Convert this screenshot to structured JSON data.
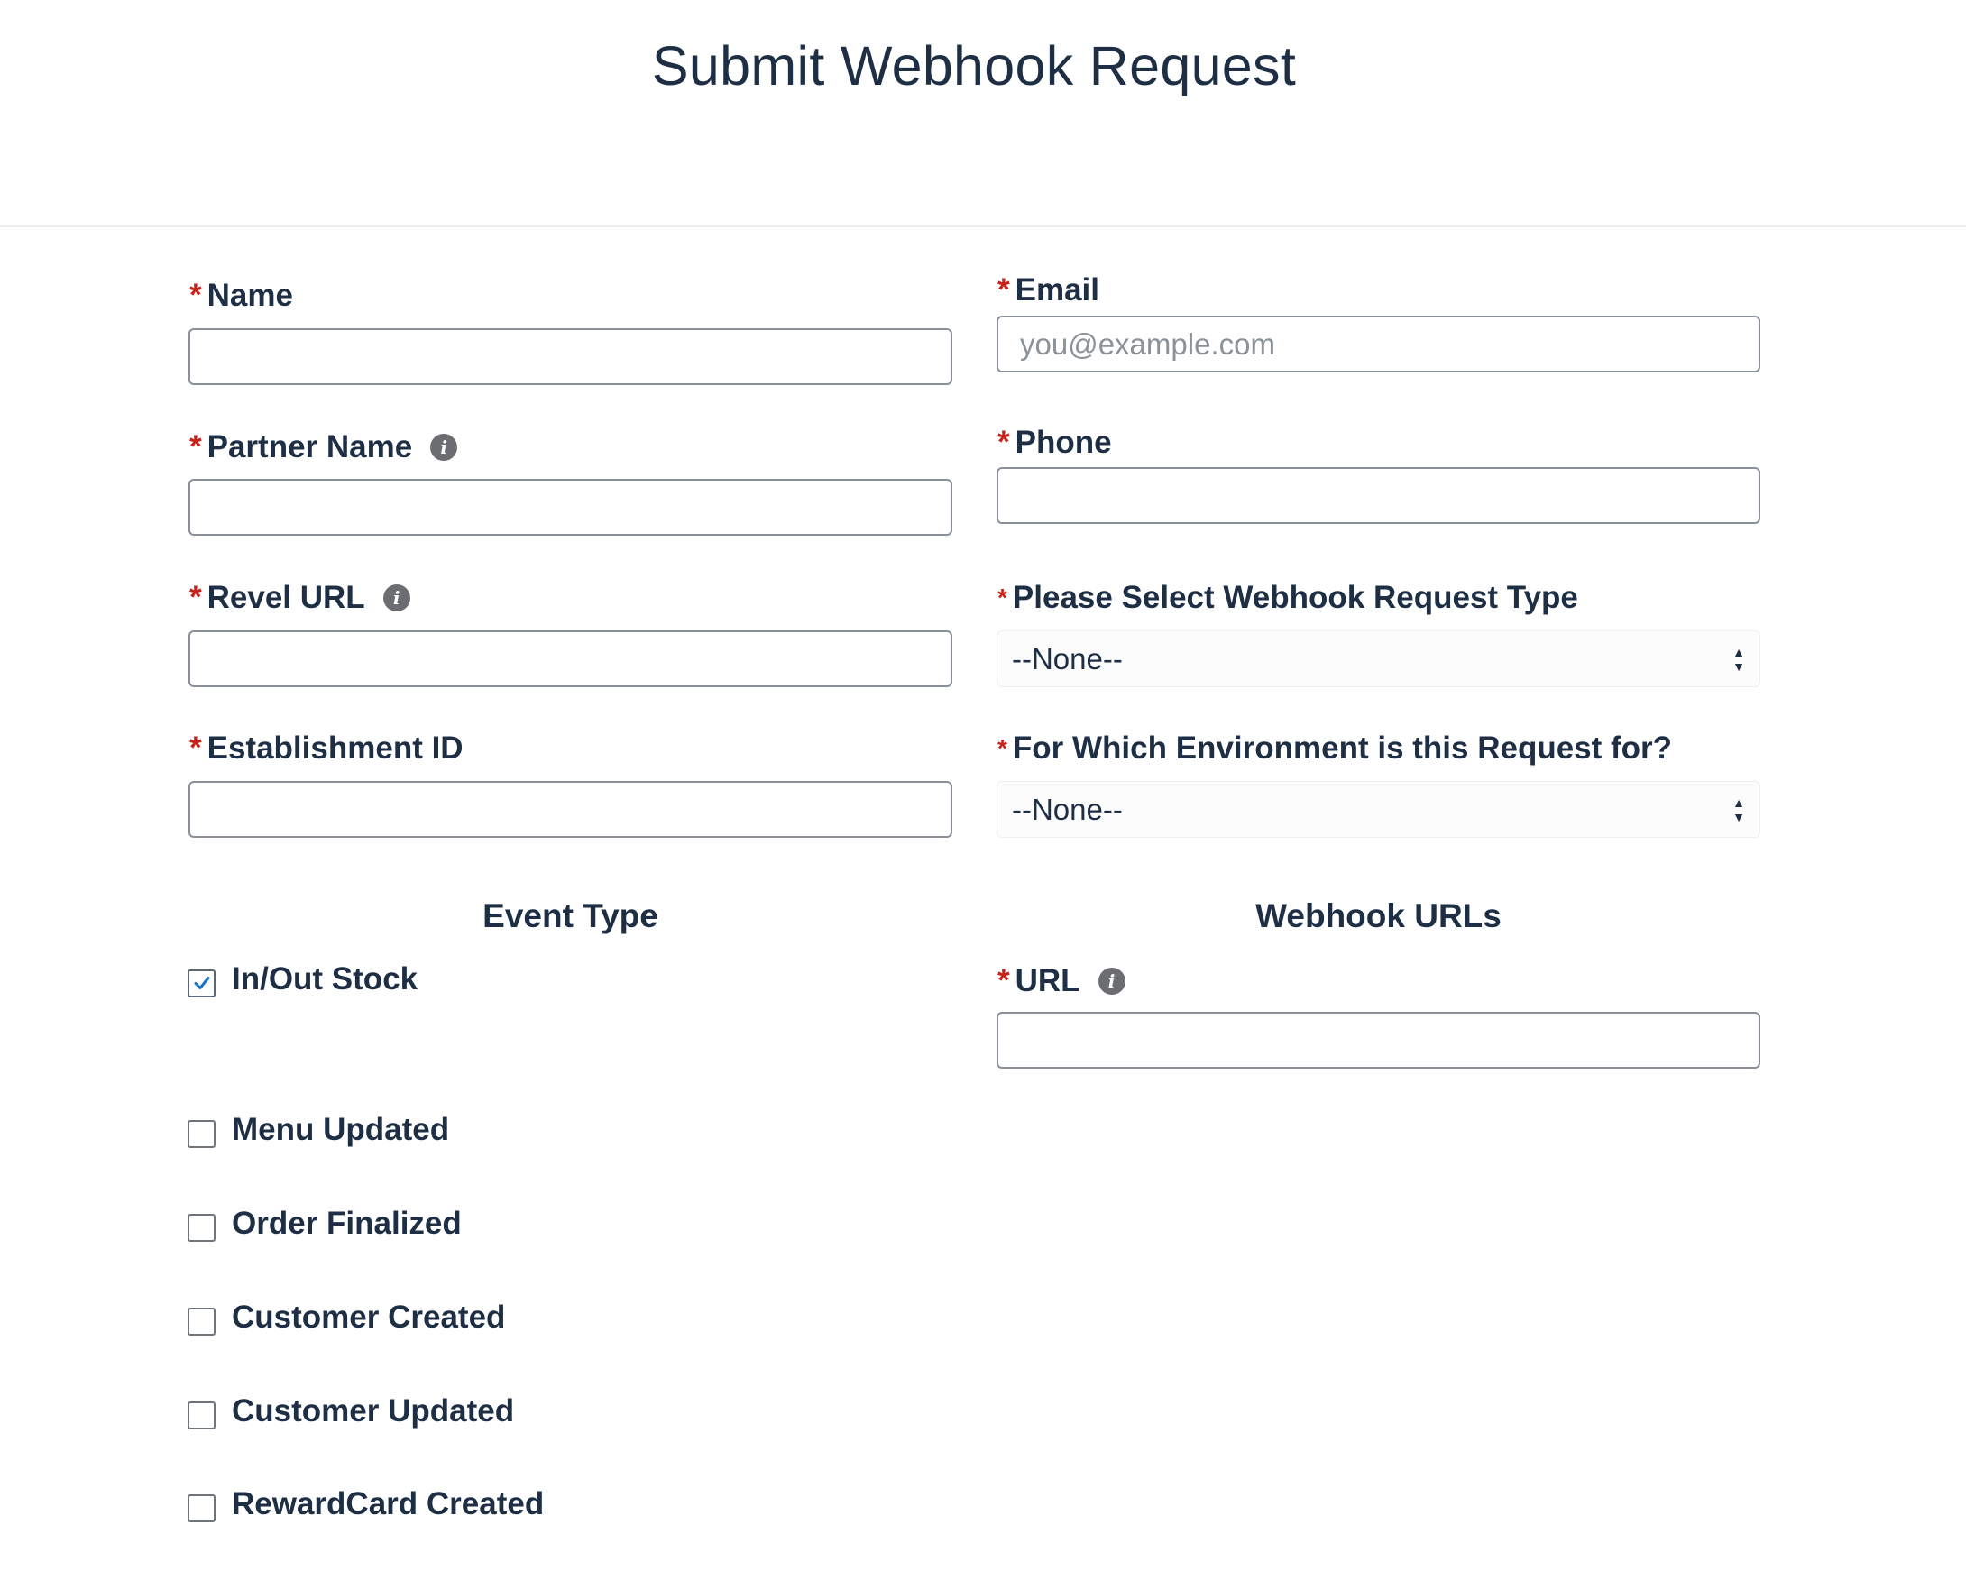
{
  "page": {
    "title": "Submit Webhook Request"
  },
  "form": {
    "required_marker": "*",
    "name": {
      "label": "Name",
      "value": "",
      "placeholder": ""
    },
    "email": {
      "label": "Email",
      "value": "",
      "placeholder": "you@example.com"
    },
    "partner_name": {
      "label": "Partner Name",
      "value": "",
      "placeholder": "",
      "info_icon": "info-icon"
    },
    "phone": {
      "label": "Phone",
      "value": "",
      "placeholder": ""
    },
    "revel_url": {
      "label": "Revel URL",
      "value": "",
      "placeholder": "",
      "info_icon": "info-icon"
    },
    "webhook_request_type": {
      "label": "Please Select Webhook Request Type",
      "selected": "--None--"
    },
    "establishment_id": {
      "label": "Establishment ID",
      "value": "",
      "placeholder": ""
    },
    "environment": {
      "label": "For Which Environment is this Request for?",
      "selected": "--None--"
    }
  },
  "event_type": {
    "heading": "Event Type",
    "items": [
      {
        "label": "In/Out Stock",
        "checked": true
      },
      {
        "label": "Menu Updated",
        "checked": false
      },
      {
        "label": "Order Finalized",
        "checked": false
      },
      {
        "label": "Customer Created",
        "checked": false
      },
      {
        "label": "Customer Updated",
        "checked": false
      },
      {
        "label": "RewardCard Created",
        "checked": false
      }
    ]
  },
  "webhook_urls": {
    "heading": "Webhook URLs",
    "url": {
      "label": "URL",
      "value": "",
      "placeholder": "",
      "info_icon": "info-icon"
    }
  },
  "colors": {
    "text": "#1e2f45",
    "required": "#c9211b",
    "check": "#1b73c8",
    "border": "#8a9099"
  }
}
